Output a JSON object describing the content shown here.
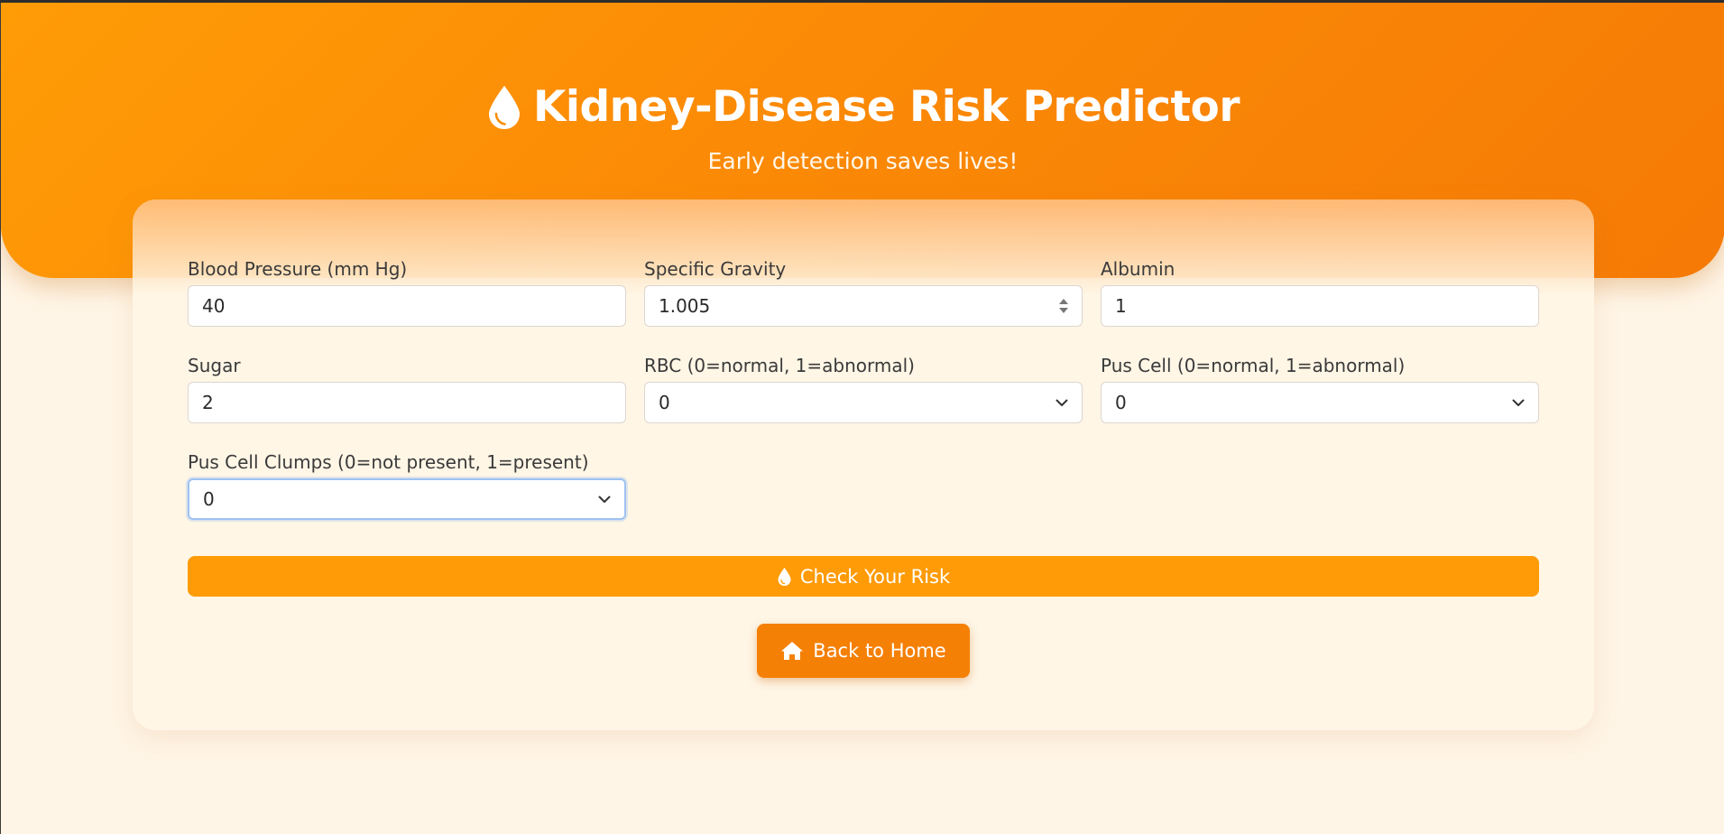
{
  "header": {
    "title": "Kidney-Disease Risk Predictor",
    "subtitle": "Early detection saves lives!",
    "icon": "droplet-icon"
  },
  "form": {
    "fields": [
      {
        "label": "Blood Pressure (mm Hg)",
        "type": "number",
        "value": "40"
      },
      {
        "label": "Specific Gravity",
        "type": "number-stepper",
        "value": "1.005"
      },
      {
        "label": "Albumin",
        "type": "number",
        "value": "1"
      },
      {
        "label": "Sugar",
        "type": "number",
        "value": "2"
      },
      {
        "label": "RBC (0=normal, 1=abnormal)",
        "type": "select",
        "value": "0"
      },
      {
        "label": "Pus Cell (0=normal, 1=abnormal)",
        "type": "select",
        "value": "0"
      },
      {
        "label": "Pus Cell Clumps (0=not present, 1=present)",
        "type": "select",
        "value": "0",
        "focused": true
      }
    ],
    "submit_label": "Check Your Risk",
    "submit_icon": "droplet-icon"
  },
  "navigation": {
    "home_label": "Back to Home",
    "home_icon": "home-icon"
  },
  "colors": {
    "accent": "#ff9b06",
    "accent_dark": "#f58006",
    "background": "#fff5e6"
  }
}
